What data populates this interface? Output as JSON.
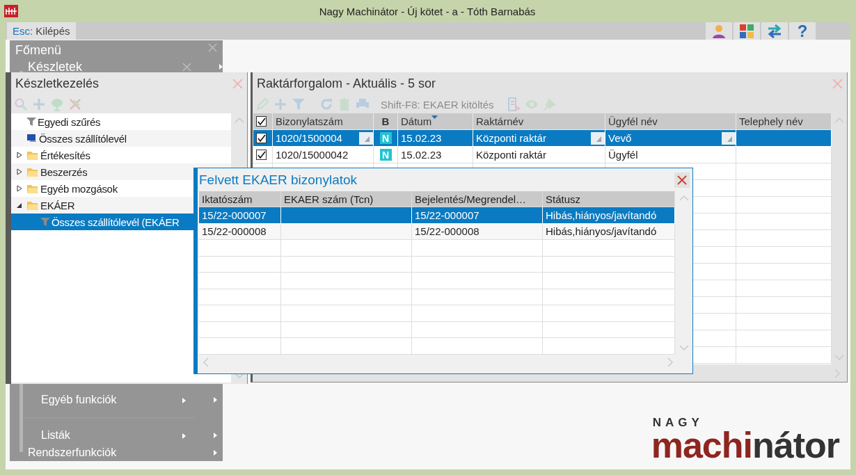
{
  "window": {
    "title": "Nagy Machinátor - Új kötet - a - Tóth Barnabás"
  },
  "toolbar": {
    "exit": {
      "key": "Esc:",
      "label": "Kilépés"
    },
    "help_label": "?"
  },
  "main_menu": {
    "title": "Főmenü",
    "submenu_title": "Készletek",
    "items": [
      {
        "kind": "submenu",
        "label": "Egyéb funkciók"
      },
      {
        "kind": "separator"
      },
      {
        "kind": "submenu",
        "label": "Listák"
      },
      {
        "kind": "top",
        "label": "Rendszerfunkciók"
      }
    ]
  },
  "tree_panel": {
    "title": "Készletkezelés",
    "items": [
      {
        "kind": "filter",
        "label": "Egyedi szűrés",
        "selected": false
      },
      {
        "kind": "monitor",
        "label": "Összes szállítólevél",
        "selected": false
      },
      {
        "kind": "folder",
        "label": "Értékesítés",
        "selected": false,
        "expanded": false
      },
      {
        "kind": "folder",
        "label": "Beszerzés",
        "selected": false,
        "expanded": false
      },
      {
        "kind": "folder",
        "label": "Egyéb mozgások",
        "selected": false,
        "expanded": false
      },
      {
        "kind": "folder",
        "label": "EKÁER",
        "selected": false,
        "expanded": true,
        "children": [
          {
            "kind": "filter",
            "label": "Összes szállítólevél (EKÁER",
            "selected": true
          }
        ]
      }
    ]
  },
  "grid_panel": {
    "title": "Raktárforgalom - Aktuális - 5 sor",
    "shortcut": {
      "label": "Shift-F8: EKAER kitöltés",
      "disabled": true
    },
    "header_checked": true,
    "columns": [
      {
        "label": "Bizonylatszám",
        "sorted": false
      },
      {
        "label": "B",
        "sorted": false
      },
      {
        "label": "Dátum",
        "sorted": true
      },
      {
        "label": "Raktárnév",
        "sorted": false
      },
      {
        "label": "Ügyfél név",
        "sorted": false
      },
      {
        "label": "Telephely név",
        "sorted": false
      }
    ],
    "rows": [
      {
        "selected": true,
        "checked": true,
        "number": "1020/1500004",
        "badge": "N",
        "date": "15.02.23",
        "warehouse": "Központi raktár",
        "customer": "Vevő"
      },
      {
        "selected": false,
        "checked": true,
        "number": "1020/15000042",
        "badge": "N",
        "date": "15.02.23",
        "warehouse": "Központi raktár",
        "customer": "Ügyfél"
      }
    ]
  },
  "dialog": {
    "title": "Felvett EKAER bizonylatok",
    "columns": [
      "Iktatószám",
      "EKAER szám (Tcn)",
      "Bejelentés/Megrendel…",
      "Státusz"
    ],
    "rows": [
      {
        "selected": true,
        "file_no": "15/22-000007",
        "report": "15/22-000007",
        "status": "Hibás,hiányos/javítandó"
      },
      {
        "selected": false,
        "file_no": "15/22-000008",
        "report": "15/22-000008",
        "status": "Hibás,hiányos/javítandó"
      }
    ]
  },
  "logo": {
    "top": "NAGY",
    "red": "machi",
    "dark": "nátor"
  }
}
